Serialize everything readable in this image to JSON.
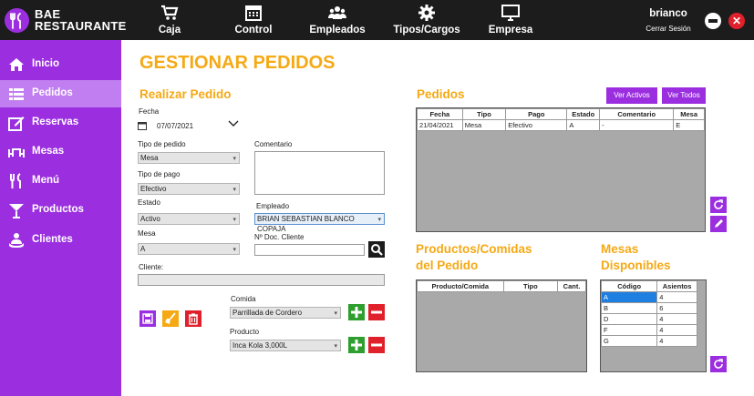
{
  "app": {
    "logo_line1": "BAE",
    "logo_line2": "RESTAURANTE"
  },
  "topnav": [
    {
      "label": "Caja",
      "icon": "cart-icon"
    },
    {
      "label": "Control",
      "icon": "calendar-icon"
    },
    {
      "label": "Empleados",
      "icon": "users-icon"
    },
    {
      "label": "Tipos/Cargos",
      "icon": "gear-icon"
    },
    {
      "label": "Empresa",
      "icon": "monitor-icon"
    }
  ],
  "user": {
    "name": "brianco",
    "logout": "Cerrar Sesión"
  },
  "sidebar": [
    {
      "label": "Inicio",
      "icon": "home-icon"
    },
    {
      "label": "Pedidos",
      "icon": "list-icon",
      "active": true
    },
    {
      "label": "Reservas",
      "icon": "edit-icon"
    },
    {
      "label": "Mesas",
      "icon": "table-icon"
    },
    {
      "label": "Menú",
      "icon": "utensils-icon"
    },
    {
      "label": "Productos",
      "icon": "cocktail-icon"
    },
    {
      "label": "Clientes",
      "icon": "clients-icon"
    }
  ],
  "page": {
    "title": "GESTIONAR PEDIDOS"
  },
  "form": {
    "heading": "Realizar Pedido",
    "fecha_label": "Fecha",
    "fecha_value": "07/07/2021",
    "tipo_pedido_label": "Tipo de pedido",
    "tipo_pedido_value": "Mesa",
    "tipo_pago_label": "Tipo de pago",
    "tipo_pago_value": "Efectivo",
    "estado_label": "Estado",
    "estado_value": "Activo",
    "mesa_label": "Mesa",
    "mesa_value": "A",
    "cliente_label": "Cliente:",
    "cliente_value": "",
    "comentario_label": "Comentario",
    "comentario_value": "",
    "empleado_label": "Empleado",
    "empleado_value": "BRIAN SEBASTIAN BLANCO COPAJA",
    "doc_label": "Nº Doc. Cliente",
    "doc_value": "",
    "comida_label": "Comida",
    "comida_value": "Parrillada de Cordero",
    "producto_label": "Producto",
    "producto_value": "Inca Kola 3,000L"
  },
  "pedidos": {
    "heading": "Pedidos",
    "btn_activos": "Ver Activos",
    "btn_todos": "Ver Todos",
    "columns": [
      "Fecha",
      "Tipo",
      "Pago",
      "Estado",
      "Comentario",
      "Mesa"
    ],
    "rows": [
      [
        "21/04/2021",
        "Mesa",
        "Efectivo",
        "A",
        "-",
        "E"
      ]
    ]
  },
  "productos": {
    "heading_line1": "Productos/Comidas",
    "heading_line2": "del Pedido",
    "columns": [
      "Producto/Comida",
      "Tipo",
      "Cant."
    ]
  },
  "mesas": {
    "heading_line1": "Mesas",
    "heading_line2": "Disponibles",
    "columns": [
      "Código",
      "Asientos"
    ],
    "rows": [
      [
        "A",
        "4"
      ],
      [
        "B",
        "6"
      ],
      [
        "D",
        "4"
      ],
      [
        "F",
        "4"
      ],
      [
        "G",
        "4"
      ]
    ]
  },
  "colors": {
    "accent": "#9b2fe0",
    "title": "#f5a915",
    "topbar": "#1c1c1c",
    "add": "#2e9e2e",
    "remove": "#e0202a"
  }
}
